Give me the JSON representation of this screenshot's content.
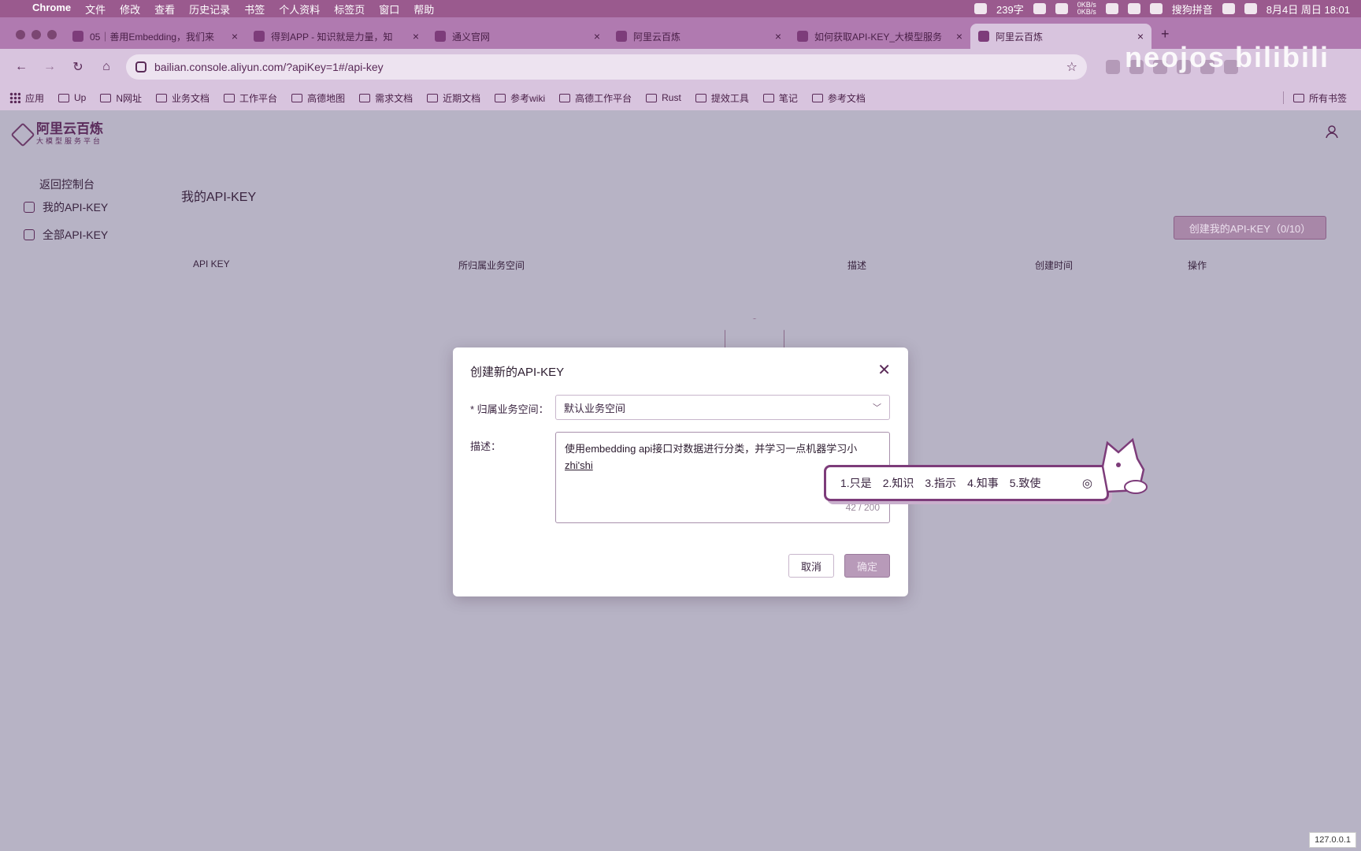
{
  "menubar": {
    "app": "Chrome",
    "menus": [
      "文件",
      "修改",
      "查看",
      "历史记录",
      "书签",
      "个人资料",
      "标签页",
      "窗口",
      "帮助"
    ],
    "word_count": "239字",
    "net_up": "0KB/s",
    "net_down": "0KB/s",
    "ime_name": "搜狗拼音",
    "datetime": "8月4日 周日 18:01"
  },
  "tabs": [
    {
      "title": "05｜善用Embedding，我们来"
    },
    {
      "title": "得到APP - 知识就是力量，知"
    },
    {
      "title": "通义官网"
    },
    {
      "title": "阿里云百炼"
    },
    {
      "title": "如何获取API-KEY_大模型服务"
    },
    {
      "title": "阿里云百炼",
      "active": true
    }
  ],
  "toolbar": {
    "url": "bailian.console.aliyun.com/?apiKey=1#/api-key"
  },
  "watermark": "neojos bilibili",
  "bookmarks": [
    {
      "label": "应用",
      "icon": "apps-grid-icon"
    },
    {
      "label": "Up",
      "icon": "folder-icon"
    },
    {
      "label": "N网址",
      "icon": "folder-icon"
    },
    {
      "label": "业务文档",
      "icon": "folder-icon"
    },
    {
      "label": "工作平台",
      "icon": "folder-icon"
    },
    {
      "label": "高德地图",
      "icon": "folder-icon"
    },
    {
      "label": "需求文档",
      "icon": "folder-icon"
    },
    {
      "label": "近期文档",
      "icon": "folder-icon"
    },
    {
      "label": "参考wiki",
      "icon": "folder-icon"
    },
    {
      "label": "高德工作平台",
      "icon": "folder-icon"
    },
    {
      "label": "Rust",
      "icon": "folder-icon"
    },
    {
      "label": "提效工具",
      "icon": "folder-icon"
    },
    {
      "label": "笔记",
      "icon": "folder-icon"
    },
    {
      "label": "参考文档",
      "icon": "folder-icon"
    }
  ],
  "all_bookmarks": "所有书签",
  "app": {
    "brand": "阿里云百炼",
    "brand_sub": "大模型服务平台",
    "back": "返回控制台",
    "sidebar": [
      "我的API-KEY",
      "全部API-KEY"
    ],
    "title": "我的API-KEY",
    "create_button": "创建我的API-KEY（0/10）",
    "columns": [
      "API KEY",
      "所归属业务空间",
      "描述",
      "创建时间",
      "操作"
    ]
  },
  "dialog": {
    "title": "创建新的API-KEY",
    "workspace_label": "* 归属业务空间：",
    "workspace_value": "默认业务空间",
    "desc_label": "描述：",
    "desc_text": "使用embedding api接口对数据进行分类，并学习一点机器学习小",
    "desc_ime": "zhi'shi",
    "counter": "42 / 200",
    "cancel": "取消",
    "ok": "确定"
  },
  "ime": {
    "candidates": [
      "1.只是",
      "2.知识",
      "3.指示",
      "4.知事",
      "5.致使"
    ]
  },
  "ip": "127.0.0.1",
  "colors": {
    "accent": "#7d3c7a",
    "overlay": "#b7b3c5"
  }
}
